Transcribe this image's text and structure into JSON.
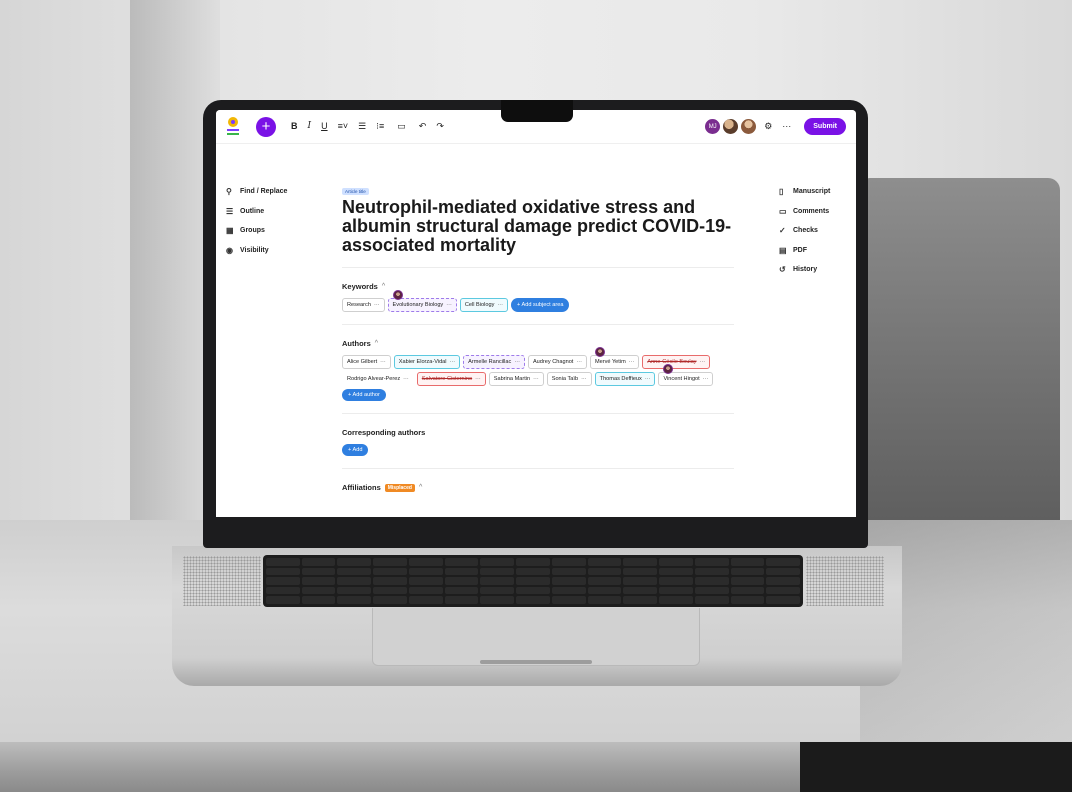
{
  "toolbar": {
    "icons": [
      "plus-icon",
      "bold-icon",
      "italic-icon",
      "underline-icon",
      "align-icon",
      "bullet-list-icon",
      "numbered-list-icon",
      "comment-add-icon",
      "undo-icon",
      "redo-icon",
      "settings-icon",
      "more-icon"
    ],
    "bold_label": "B",
    "italic_label": "I",
    "underline_label": "U",
    "avatar_initials": "MJ",
    "more_label": "···",
    "submit_label": "Submit"
  },
  "left_nav": {
    "items": [
      {
        "label": "Find / Replace",
        "icon": "search-icon"
      },
      {
        "label": "Outline",
        "icon": "outline-icon"
      },
      {
        "label": "Groups",
        "icon": "groups-icon"
      },
      {
        "label": "Visibility",
        "icon": "eye-icon"
      }
    ]
  },
  "right_nav": {
    "items": [
      {
        "label": "Manuscript",
        "icon": "document-icon"
      },
      {
        "label": "Comments",
        "icon": "comment-icon"
      },
      {
        "label": "Checks",
        "icon": "check-icon"
      },
      {
        "label": "PDF",
        "icon": "pdf-icon"
      },
      {
        "label": "History",
        "icon": "history-icon"
      }
    ]
  },
  "document": {
    "title_badge": "Article title",
    "title": "Neutrophil-mediated oxidative stress and albumin structural damage predict COVID-19-associated mortality",
    "keywords": {
      "heading": "Keywords",
      "chips": [
        {
          "label": "Research",
          "style": "default"
        },
        {
          "label": "Evolutionary Biology",
          "style": "purple"
        },
        {
          "label": "Cell Biology",
          "style": "cyan"
        }
      ],
      "add_label": "+ Add subject area"
    },
    "authors": {
      "heading": "Authors",
      "chips": [
        {
          "label": "Alice Gilbert",
          "style": "default"
        },
        {
          "label": "Xabier Elorza-Vidal",
          "style": "cyan"
        },
        {
          "label": "Armelle Rancillac",
          "style": "purple"
        },
        {
          "label": "Audrey Chagnot",
          "style": "default"
        },
        {
          "label": "Mervé Yetim",
          "style": "default"
        },
        {
          "label": "Anne-Cécile Boulay",
          "style": "red"
        },
        {
          "label": "Rodrigo Alvear-Perez",
          "style": "plain"
        },
        {
          "label": "Salvatore Cisternino",
          "style": "red"
        },
        {
          "label": "Sabrina Martin",
          "style": "default"
        },
        {
          "label": "Sonia Taïb",
          "style": "default"
        },
        {
          "label": "Thomas Deffieux",
          "style": "cyan"
        },
        {
          "label": "Vincent Hingot",
          "style": "default"
        }
      ],
      "add_label": "+ Add author"
    },
    "corresponding": {
      "heading": "Corresponding authors",
      "add_label": "+ Add"
    },
    "affiliations": {
      "heading": "Affiliations",
      "badge": "Misplaced"
    },
    "chip_more": "···",
    "chevron": "^"
  }
}
